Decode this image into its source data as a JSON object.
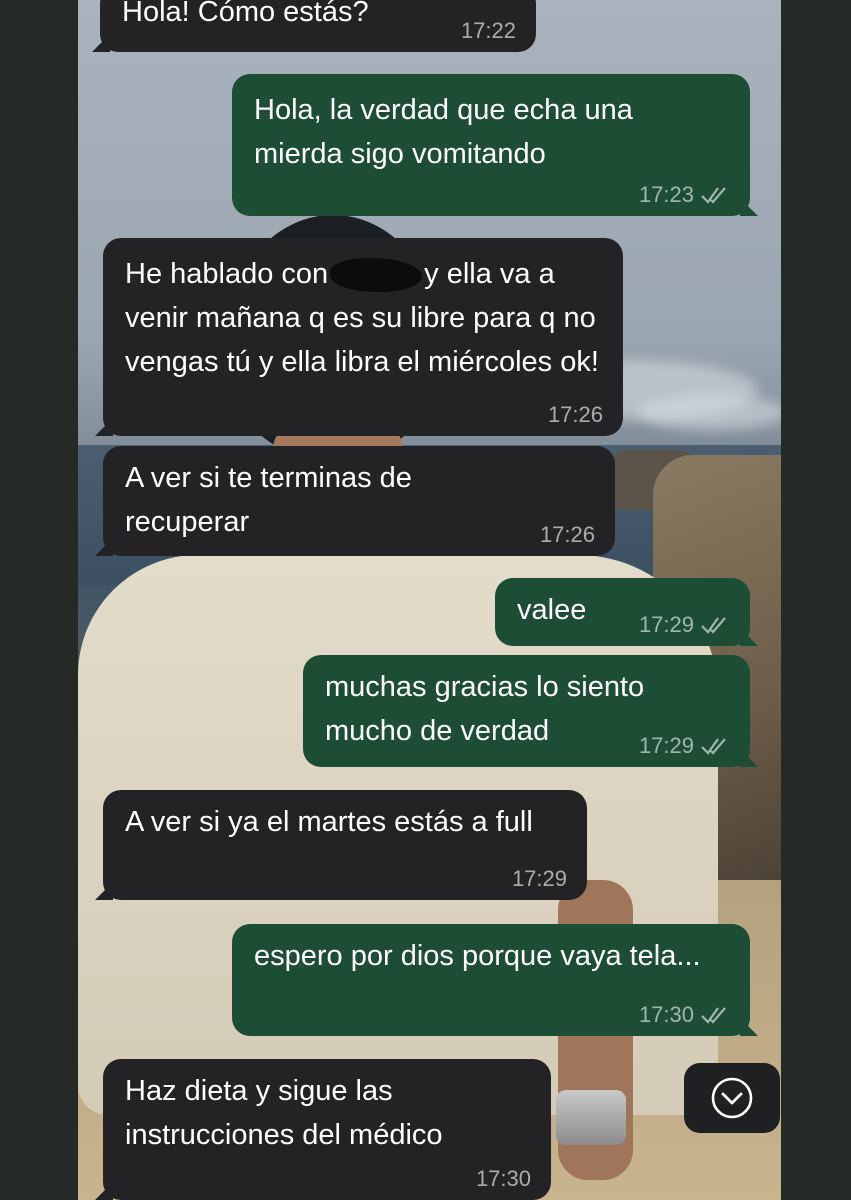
{
  "chat": {
    "messages": [
      {
        "direction": "incoming",
        "text": "Hola! Cómo estás?",
        "time": "17:22"
      },
      {
        "direction": "outgoing",
        "text": "Hola, la verdad que echa una mierda sigo vomitando",
        "time": "17:23",
        "status": "read"
      },
      {
        "direction": "incoming",
        "text_before": "He hablado con",
        "text_after": "y ella va a venir mañana q es su libre para q no vengas tú y ella libra el miércoles ok!",
        "time": "17:26"
      },
      {
        "direction": "incoming",
        "text": "A ver si te terminas de recuperar",
        "time": "17:26"
      },
      {
        "direction": "outgoing",
        "text": "valee",
        "time": "17:29",
        "status": "read"
      },
      {
        "direction": "outgoing",
        "text": "muchas gracias lo siento mucho de verdad",
        "time": "17:29",
        "status": "read"
      },
      {
        "direction": "incoming",
        "text": "A ver si ya el martes estás a full",
        "time": "17:29"
      },
      {
        "direction": "outgoing",
        "text": "espero por dios porque vaya tela...",
        "time": "17:30",
        "status": "read"
      },
      {
        "direction": "incoming",
        "text": "Haz dieta y sigue las instrucciones del médico",
        "time": "17:30"
      }
    ]
  },
  "scroll_button": {
    "icon": "chevron-down-circle-icon"
  },
  "colors": {
    "incoming_bubble": "#232326",
    "outgoing_bubble": "#1e4d35",
    "text": "#ffffff"
  }
}
